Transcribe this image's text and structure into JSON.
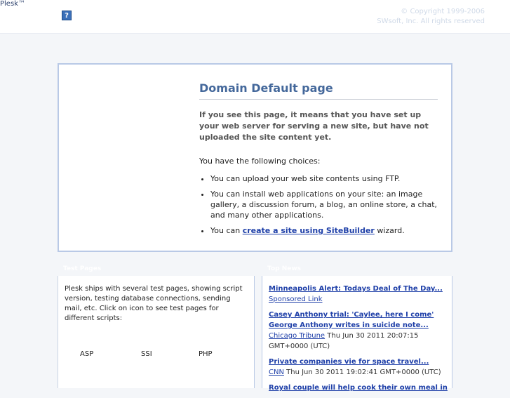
{
  "header": {
    "logo": "Plesk™",
    "help_icon": "?",
    "copyright_line1": "© Copyright 1999-2006",
    "copyright_line2": "SWsoft, Inc. All rights reserved"
  },
  "main": {
    "heading": "Domain Default page",
    "intro": "If you see this page, it means that you have set up your web server for serving a new site, but have not uploaded the site content yet.",
    "choices_label": "You have the following choices:",
    "choices": [
      "You can upload your web site contents using FTP.",
      "You can install web applications on your site: an image gallery, a discussion forum, a blog, an online store, a chat, and many other applications."
    ],
    "sitebuilder_prefix": "You can ",
    "sitebuilder_link": "create a site using SiteBuilder",
    "sitebuilder_suffix": " wizard."
  },
  "test_pages": {
    "title": "Test Pages",
    "description": "Plesk ships with several test pages, showing script version, testing database connections, sending mail, etc. Click on icon to see test pages for different scripts:",
    "scripts": [
      "ASP",
      "SSI",
      "PHP"
    ]
  },
  "news": {
    "title": "Top News",
    "items": [
      {
        "title": "Minneapolis Alert: Todays Deal of The Day...",
        "source": "Sponsored Link",
        "date": ""
      },
      {
        "title": "Casey Anthony trial: 'Caylee, here I come' George Anthony writes in suicide note...",
        "source": "Chicago Tribune",
        "date": "Thu Jun 30 2011 20:07:15 GMT+0000 (UTC)"
      },
      {
        "title": "Private companies vie for space travel...",
        "source": "CNN",
        "date": "Thu Jun 30 2011 19:02:41 GMT+0000 (UTC)"
      },
      {
        "title": "Royal couple will help cook their own meal in",
        "source": "",
        "date": ""
      }
    ]
  }
}
